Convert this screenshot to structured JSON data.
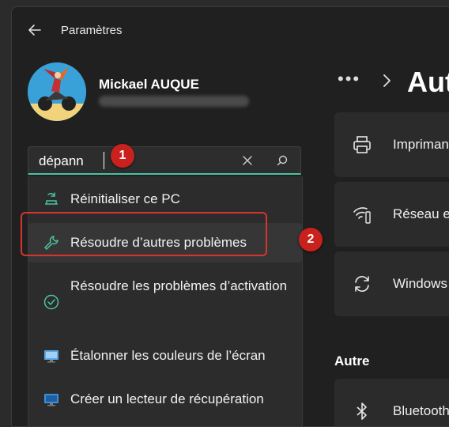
{
  "app": {
    "title": "Paramètres"
  },
  "user": {
    "name": "Mickael AUQUE"
  },
  "search": {
    "value": "dépann"
  },
  "suggestions": [
    {
      "label": "Réinitialiser ce PC",
      "icon": "reset-pc-icon"
    },
    {
      "label": "Résoudre d’autres problèmes",
      "icon": "wrench-icon"
    },
    {
      "label": "Résoudre les problèmes d’activation",
      "icon": "activation-check-icon"
    },
    {
      "label": "Étalonner les couleurs de l’écran",
      "icon": "monitor-color-icon"
    },
    {
      "label": "Créer un lecteur de récupération",
      "icon": "recovery-drive-icon"
    }
  ],
  "annotations": {
    "badge1": "1",
    "badge2": "2"
  },
  "breadcrumb": {
    "dots": "•••",
    "page_title": "Aut"
  },
  "cards": [
    {
      "label": "Imprimant",
      "icon": "printer-icon"
    },
    {
      "label": "Réseau et",
      "icon": "network-icon"
    },
    {
      "label": "Windows",
      "icon": "sync-icon"
    },
    {
      "label": "Bluetooth",
      "icon": "bluetooth-icon"
    }
  ],
  "sections": {
    "autre": "Autre"
  },
  "colors": {
    "accent": "#4cc2a2",
    "annotation": "#d9342b"
  }
}
